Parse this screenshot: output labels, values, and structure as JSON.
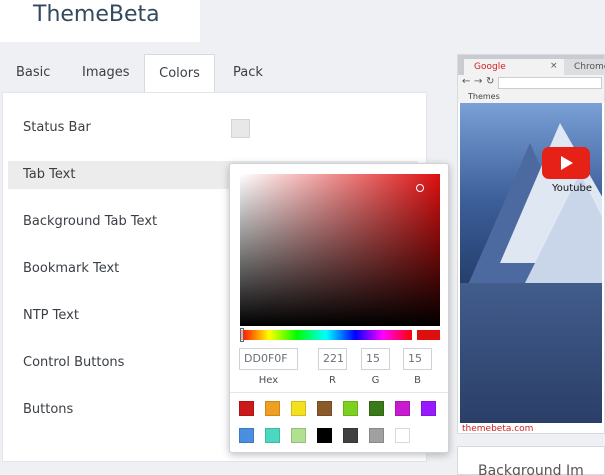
{
  "brand": "ThemeBeta",
  "tabs": [
    {
      "label": "Basic"
    },
    {
      "label": "Images"
    },
    {
      "label": "Colors"
    },
    {
      "label": "Pack"
    }
  ],
  "color_items": [
    {
      "label": "Status Bar"
    },
    {
      "label": "Tab Text"
    },
    {
      "label": "Background Tab Text"
    },
    {
      "label": "Bookmark Text"
    },
    {
      "label": "NTP Text"
    },
    {
      "label": "Control Buttons"
    },
    {
      "label": "Buttons"
    }
  ],
  "picker": {
    "hex_value": "DD0F0F",
    "r_value": "221",
    "g_value": "15",
    "b_value": "15",
    "hex_label": "Hex",
    "r_label": "R",
    "g_label": "G",
    "b_label": "B",
    "current_color": "#dd0f0f",
    "palette": [
      "#cc1a1a",
      "#f0a020",
      "#f5e020",
      "#8b5a2b",
      "#7dd020",
      "#3a7a18",
      "#c81ad0",
      "#9a1aff",
      "#4a8ee0",
      "#4ad8c0",
      "#b0e090",
      "#000000",
      "#404040",
      "#a0a0a0",
      "#ffffff"
    ]
  },
  "preview": {
    "tab_active": "Google",
    "tab_inactive": "Chrome",
    "close_glyph": "×",
    "bookmark": "Themes",
    "youtube_label": "Youtube",
    "site": "themebeta.com"
  },
  "bottom_card_text": "Background Im"
}
